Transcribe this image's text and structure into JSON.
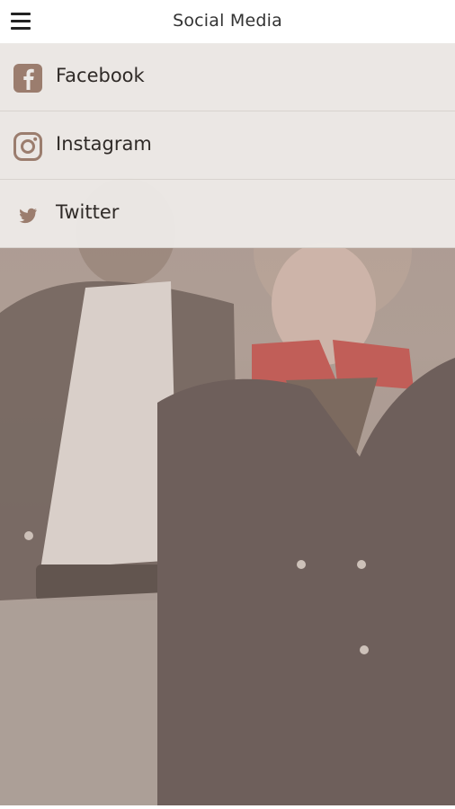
{
  "header": {
    "title": "Social Media"
  },
  "menu": {
    "items": [
      {
        "label": "Facebook",
        "icon": "facebook-icon"
      },
      {
        "label": "Instagram",
        "icon": "instagram-icon"
      },
      {
        "label": "Twitter",
        "icon": "twitter-icon"
      }
    ]
  },
  "colors": {
    "accent": "#9b7d6e",
    "menu_bg": "#ece9e6",
    "header_bg": "#ffffff"
  }
}
